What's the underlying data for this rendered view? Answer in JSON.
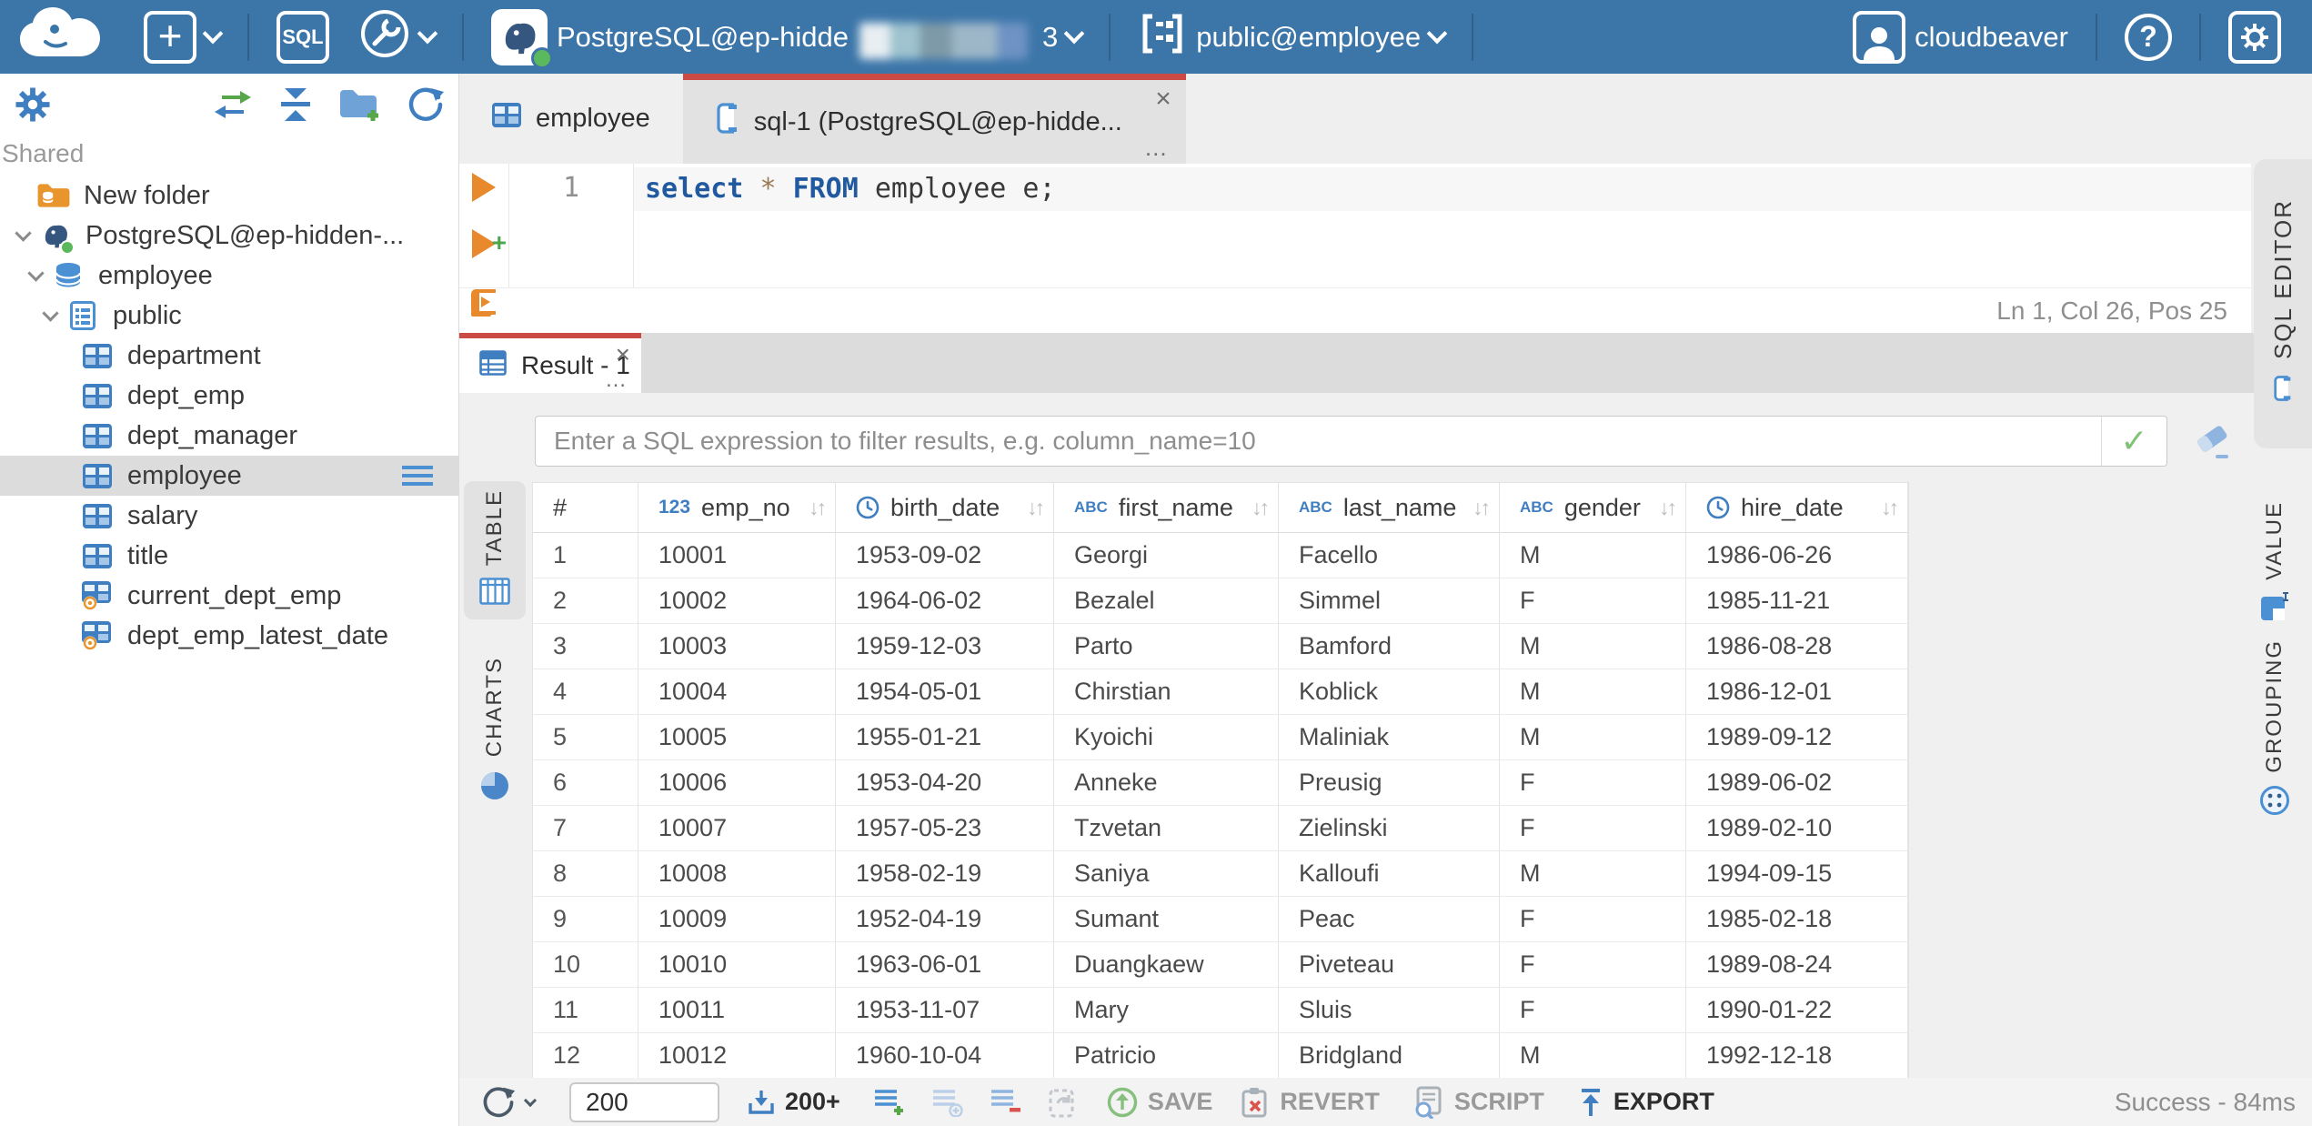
{
  "ui": {
    "close_glyph": "×",
    "more_glyph": "…",
    "sort_glyph": "↓↑",
    "check_glyph": "✓",
    "plus_glyph": "+",
    "help_glyph": "?",
    "hash": "#"
  },
  "colors": {
    "topbar": "#3c76a9",
    "tab_accent": "#cb4a44",
    "icon_blue": "#3f7fc1",
    "exec_orange": "#e8892c",
    "status_green": "#5cb85c"
  },
  "header": {
    "sql_button_label": "SQL",
    "connection_name": "PostgreSQL@ep-hidde",
    "connection_suffix": "3",
    "schema_label": "public@employee",
    "username": "cloudbeaver"
  },
  "sidebar": {
    "section_label": "Shared",
    "items": [
      {
        "label": "New folder",
        "type": "folder"
      },
      {
        "label": "PostgreSQL@ep-hidden-...",
        "type": "connection"
      },
      {
        "label": "employee",
        "type": "database"
      },
      {
        "label": "public",
        "type": "schema"
      },
      {
        "label": "department",
        "type": "table"
      },
      {
        "label": "dept_emp",
        "type": "table"
      },
      {
        "label": "dept_manager",
        "type": "table"
      },
      {
        "label": "employee",
        "type": "table",
        "selected": true
      },
      {
        "label": "salary",
        "type": "table"
      },
      {
        "label": "title",
        "type": "table"
      },
      {
        "label": "current_dept_emp",
        "type": "view"
      },
      {
        "label": "dept_emp_latest_date",
        "type": "view"
      }
    ]
  },
  "tabs": {
    "employee_tab": "employee",
    "sql_tab": "sql-1 (PostgreSQL@ep-hidde..."
  },
  "editor": {
    "line": "1",
    "kw1": "select",
    "star": "*",
    "kw2": "FROM",
    "rest": "employee e;",
    "status": "Ln 1, Col 26, Pos 25",
    "side_tab": "SQL EDITOR"
  },
  "result": {
    "tab_label": "Result - 1",
    "filter_placeholder": "Enter a SQL expression to filter results, e.g. column_name=10",
    "table_tab": "TABLE",
    "charts_tab": "CHARTS",
    "value_tab": "VALUE",
    "grouping_tab": "GROUPING"
  },
  "grid": {
    "columns": [
      {
        "label": "#",
        "type": "rownum"
      },
      {
        "label": "emp_no",
        "type": "number"
      },
      {
        "label": "birth_date",
        "type": "date"
      },
      {
        "label": "first_name",
        "type": "string"
      },
      {
        "label": "last_name",
        "type": "string"
      },
      {
        "label": "gender",
        "type": "string"
      },
      {
        "label": "hire_date",
        "type": "date"
      }
    ],
    "rows": [
      [
        "1",
        "10001",
        "1953-09-02",
        "Georgi",
        "Facello",
        "M",
        "1986-06-26"
      ],
      [
        "2",
        "10002",
        "1964-06-02",
        "Bezalel",
        "Simmel",
        "F",
        "1985-11-21"
      ],
      [
        "3",
        "10003",
        "1959-12-03",
        "Parto",
        "Bamford",
        "M",
        "1986-08-28"
      ],
      [
        "4",
        "10004",
        "1954-05-01",
        "Chirstian",
        "Koblick",
        "M",
        "1986-12-01"
      ],
      [
        "5",
        "10005",
        "1955-01-21",
        "Kyoichi",
        "Maliniak",
        "M",
        "1989-09-12"
      ],
      [
        "6",
        "10006",
        "1953-04-20",
        "Anneke",
        "Preusig",
        "F",
        "1989-06-02"
      ],
      [
        "7",
        "10007",
        "1957-05-23",
        "Tzvetan",
        "Zielinski",
        "F",
        "1989-02-10"
      ],
      [
        "8",
        "10008",
        "1958-02-19",
        "Saniya",
        "Kalloufi",
        "M",
        "1994-09-15"
      ],
      [
        "9",
        "10009",
        "1952-04-19",
        "Sumant",
        "Peac",
        "F",
        "1985-02-18"
      ],
      [
        "10",
        "10010",
        "1963-06-01",
        "Duangkaew",
        "Piveteau",
        "F",
        "1989-08-24"
      ],
      [
        "11",
        "10011",
        "1953-11-07",
        "Mary",
        "Sluis",
        "F",
        "1990-01-22"
      ],
      [
        "12",
        "10012",
        "1960-10-04",
        "Patricio",
        "Bridgland",
        "M",
        "1992-12-18"
      ]
    ]
  },
  "footer": {
    "fetch_size": "200",
    "fetch_more": "200+",
    "save": "SAVE",
    "revert": "REVERT",
    "script": "SCRIPT",
    "export": "EXPORT",
    "status": "Success - 84ms"
  }
}
